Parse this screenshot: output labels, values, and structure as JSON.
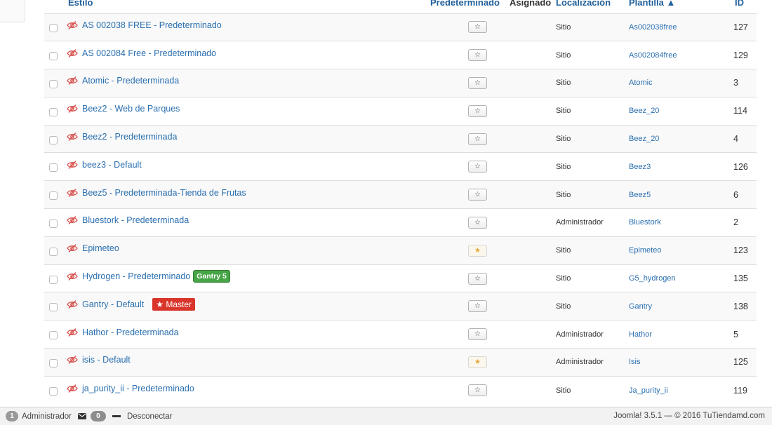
{
  "table": {
    "headers": {
      "style": "Estilo",
      "default": "Predeterminado",
      "assigned": "Asignado",
      "location": "Localización",
      "template": "Plantilla ▲",
      "id": "ID"
    },
    "rows": [
      {
        "style": "AS 002038 FREE - Predeterminado",
        "default_active": false,
        "location": "Sitio",
        "template": "As002038free",
        "id": "127"
      },
      {
        "style": "AS 002084 Free - Predeterminado",
        "default_active": false,
        "location": "Sitio",
        "template": "As002084free",
        "id": "129"
      },
      {
        "style": "Atomic - Predeterminada",
        "default_active": false,
        "location": "Sitio",
        "template": "Atomic",
        "id": "3"
      },
      {
        "style": "Beez2 - Web de Parques",
        "default_active": false,
        "location": "Sitio",
        "template": "Beez_20",
        "id": "114"
      },
      {
        "style": "Beez2 - Predeterminada",
        "default_active": false,
        "location": "Sitio",
        "template": "Beez_20",
        "id": "4"
      },
      {
        "style": "beez3 - Default",
        "default_active": false,
        "location": "Sitio",
        "template": "Beez3",
        "id": "126"
      },
      {
        "style": "Beez5 - Predeterminada-Tienda de Frutas",
        "default_active": false,
        "location": "Sitio",
        "template": "Beez5",
        "id": "6"
      },
      {
        "style": "Bluestork - Predeterminada",
        "default_active": false,
        "location": "Administrador",
        "template": "Bluestork",
        "id": "2"
      },
      {
        "style": "Epimeteo",
        "default_active": true,
        "location": "Sitio",
        "template": "Epimeteo",
        "id": "123"
      },
      {
        "style": "Hydrogen - Predeterminado",
        "default_active": false,
        "location": "Sitio",
        "template": "G5_hydrogen",
        "id": "135",
        "badge": "Gantry 5",
        "badge_type": "gantry"
      },
      {
        "style": "Gantry - Default",
        "default_active": false,
        "location": "Sitio",
        "template": "Gantry",
        "id": "138",
        "badge": "★ Master",
        "badge_type": "master"
      },
      {
        "style": "Hathor - Predeterminada",
        "default_active": false,
        "location": "Administrador",
        "template": "Hathor",
        "id": "5"
      },
      {
        "style": "isis - Default",
        "default_active": true,
        "location": "Administrador",
        "template": "Isis",
        "id": "125"
      },
      {
        "style": "ja_purity_ii - Predeterminado",
        "default_active": false,
        "location": "Sitio",
        "template": "Ja_purity_ii",
        "id": "119"
      }
    ],
    "star_glyph": "☆",
    "star_active_glyph": "★",
    "hidden_icon": "eye-slash-icon",
    "colors": {
      "link": "#2a6fb0",
      "eye_slash": "#d9534f",
      "gantry_badge": "#46a546",
      "master_badge": "#d9352b",
      "star_active": "#e3a73a"
    }
  },
  "footer": {
    "users_online_count": "1",
    "users_label": "Administrador",
    "messages_count": "0",
    "logout_label": "Desconectar",
    "version_text": "Joomla! 3.5.1  —  © 2016 TuTiendamd.com"
  }
}
